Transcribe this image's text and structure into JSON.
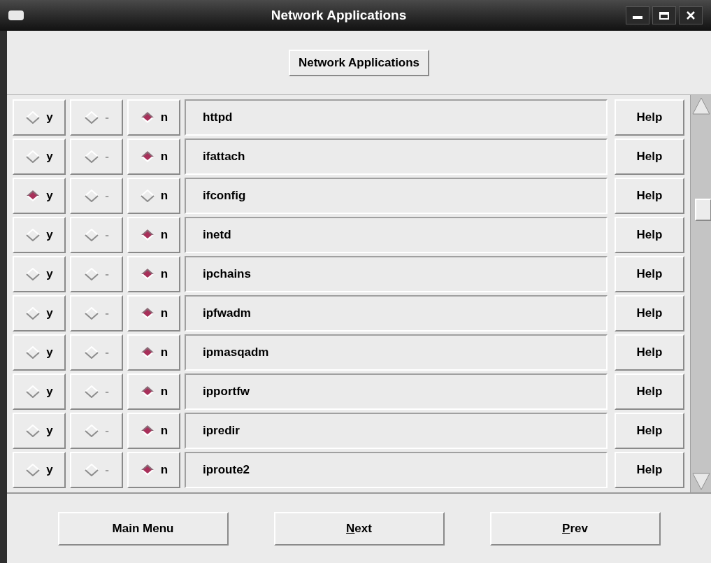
{
  "window": {
    "title": "Network Applications"
  },
  "header_button": "Network Applications",
  "rows": [
    {
      "options": [
        {
          "label": "y",
          "selected": false
        },
        {
          "label": "-",
          "selected": false
        },
        {
          "label": "n",
          "selected": true
        }
      ],
      "name": "httpd",
      "help": "Help"
    },
    {
      "options": [
        {
          "label": "y",
          "selected": false
        },
        {
          "label": "-",
          "selected": false
        },
        {
          "label": "n",
          "selected": true
        }
      ],
      "name": "ifattach",
      "help": "Help"
    },
    {
      "options": [
        {
          "label": "y",
          "selected": true
        },
        {
          "label": "-",
          "selected": false
        },
        {
          "label": "n",
          "selected": false
        }
      ],
      "name": "ifconfig",
      "help": "Help"
    },
    {
      "options": [
        {
          "label": "y",
          "selected": false
        },
        {
          "label": "-",
          "selected": false
        },
        {
          "label": "n",
          "selected": true
        }
      ],
      "name": "inetd",
      "help": "Help"
    },
    {
      "options": [
        {
          "label": "y",
          "selected": false
        },
        {
          "label": "-",
          "selected": false
        },
        {
          "label": "n",
          "selected": true
        }
      ],
      "name": "ipchains",
      "help": "Help"
    },
    {
      "options": [
        {
          "label": "y",
          "selected": false
        },
        {
          "label": "-",
          "selected": false
        },
        {
          "label": "n",
          "selected": true
        }
      ],
      "name": "ipfwadm",
      "help": "Help"
    },
    {
      "options": [
        {
          "label": "y",
          "selected": false
        },
        {
          "label": "-",
          "selected": false
        },
        {
          "label": "n",
          "selected": true
        }
      ],
      "name": "ipmasqadm",
      "help": "Help"
    },
    {
      "options": [
        {
          "label": "y",
          "selected": false
        },
        {
          "label": "-",
          "selected": false
        },
        {
          "label": "n",
          "selected": true
        }
      ],
      "name": "ipportfw",
      "help": "Help"
    },
    {
      "options": [
        {
          "label": "y",
          "selected": false
        },
        {
          "label": "-",
          "selected": false
        },
        {
          "label": "n",
          "selected": true
        }
      ],
      "name": "ipredir",
      "help": "Help"
    },
    {
      "options": [
        {
          "label": "y",
          "selected": false
        },
        {
          "label": "-",
          "selected": false
        },
        {
          "label": "n",
          "selected": true
        }
      ],
      "name": "iproute2",
      "help": "Help"
    }
  ],
  "buttons": [
    {
      "rest": "Main Menu"
    },
    {
      "mnemonic": "N",
      "rest": "ext"
    },
    {
      "mnemonic": "P",
      "rest": "rev"
    }
  ]
}
